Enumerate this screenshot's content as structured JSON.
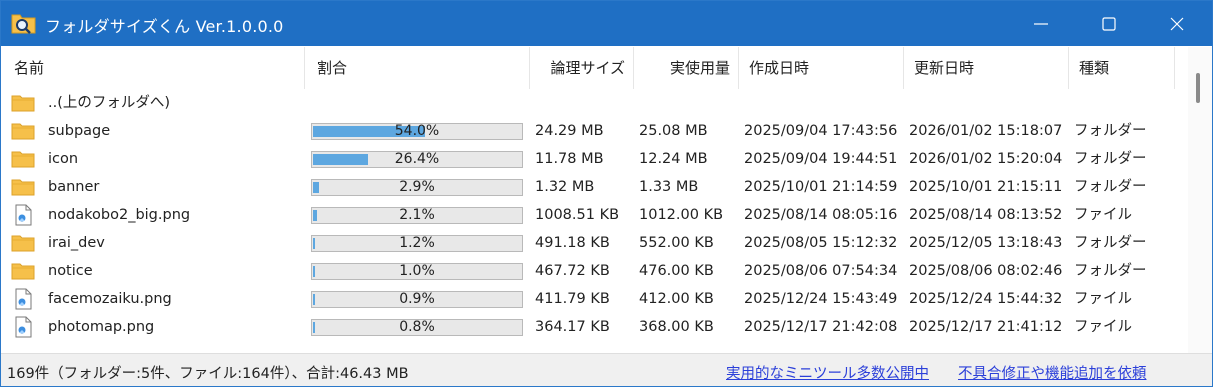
{
  "window": {
    "title": "フォルダサイズくん Ver.1.0.0.0",
    "controls": {
      "minimize": "minimize",
      "maximize": "maximize",
      "close": "close"
    }
  },
  "columns": [
    "名前",
    "割合",
    "論理サイズ",
    "実使用量",
    "作成日時",
    "更新日時",
    "種類"
  ],
  "rows": [
    {
      "icon": "folder-icon",
      "name": "..(上のフォルダへ)",
      "percent": null,
      "percent_label": "",
      "size": "",
      "alloc": "",
      "created": "",
      "updated": "",
      "type": ""
    },
    {
      "icon": "folder-icon",
      "name": "subpage",
      "percent": 54.0,
      "percent_label": "54.0%",
      "size": "24.29 MB",
      "alloc": "25.08 MB",
      "created": "2025/09/04 17:43:56",
      "updated": "2026/01/02 15:18:07",
      "type": "フォルダー"
    },
    {
      "icon": "folder-icon",
      "name": "icon",
      "percent": 26.4,
      "percent_label": "26.4%",
      "size": "11.78 MB",
      "alloc": "12.24 MB",
      "created": "2025/09/04 19:44:51",
      "updated": "2026/01/02 15:20:04",
      "type": "フォルダー"
    },
    {
      "icon": "folder-icon",
      "name": "banner",
      "percent": 2.9,
      "percent_label": "2.9%",
      "size": "1.32 MB",
      "alloc": "1.33 MB",
      "created": "2025/10/01 21:14:59",
      "updated": "2025/10/01 21:15:11",
      "type": "フォルダー"
    },
    {
      "icon": "image-file-icon",
      "name": "nodakobo2_big.png",
      "percent": 2.1,
      "percent_label": "2.1%",
      "size": "1008.51 KB",
      "alloc": "1012.00 KB",
      "created": "2025/08/14 08:05:16",
      "updated": "2025/08/14 08:13:52",
      "type": "ファイル"
    },
    {
      "icon": "folder-icon",
      "name": "irai_dev",
      "percent": 1.2,
      "percent_label": "1.2%",
      "size": "491.18 KB",
      "alloc": "552.00 KB",
      "created": "2025/08/05 15:12:32",
      "updated": "2025/12/05 13:18:43",
      "type": "フォルダー"
    },
    {
      "icon": "folder-icon",
      "name": "notice",
      "percent": 1.0,
      "percent_label": "1.0%",
      "size": "467.72 KB",
      "alloc": "476.00 KB",
      "created": "2025/08/06 07:54:34",
      "updated": "2025/08/06 08:02:46",
      "type": "フォルダー"
    },
    {
      "icon": "image-file-icon",
      "name": "facemozaiku.png",
      "percent": 0.9,
      "percent_label": "0.9%",
      "size": "411.79 KB",
      "alloc": "412.00 KB",
      "created": "2025/12/24 15:43:49",
      "updated": "2025/12/24 15:44:32",
      "type": "ファイル"
    },
    {
      "icon": "image-file-icon",
      "name": "photomap.png",
      "percent": 0.8,
      "percent_label": "0.8%",
      "size": "364.17 KB",
      "alloc": "368.00 KB",
      "created": "2025/12/17 21:42:08",
      "updated": "2025/12/17 21:41:12",
      "type": "ファイル"
    }
  ],
  "status": {
    "summary": "169件（フォルダー:5件、ファイル:164件）、合計:46.43 MB",
    "link_tools": "実用的なミニツール多数公開中",
    "link_request": "不具合修正や機能追加を依頼"
  },
  "colors": {
    "titlebar": "#1f6fc4",
    "bar_fill": "#5da7e0",
    "folder": "#f6c04a",
    "link": "#2b3fd9"
  }
}
